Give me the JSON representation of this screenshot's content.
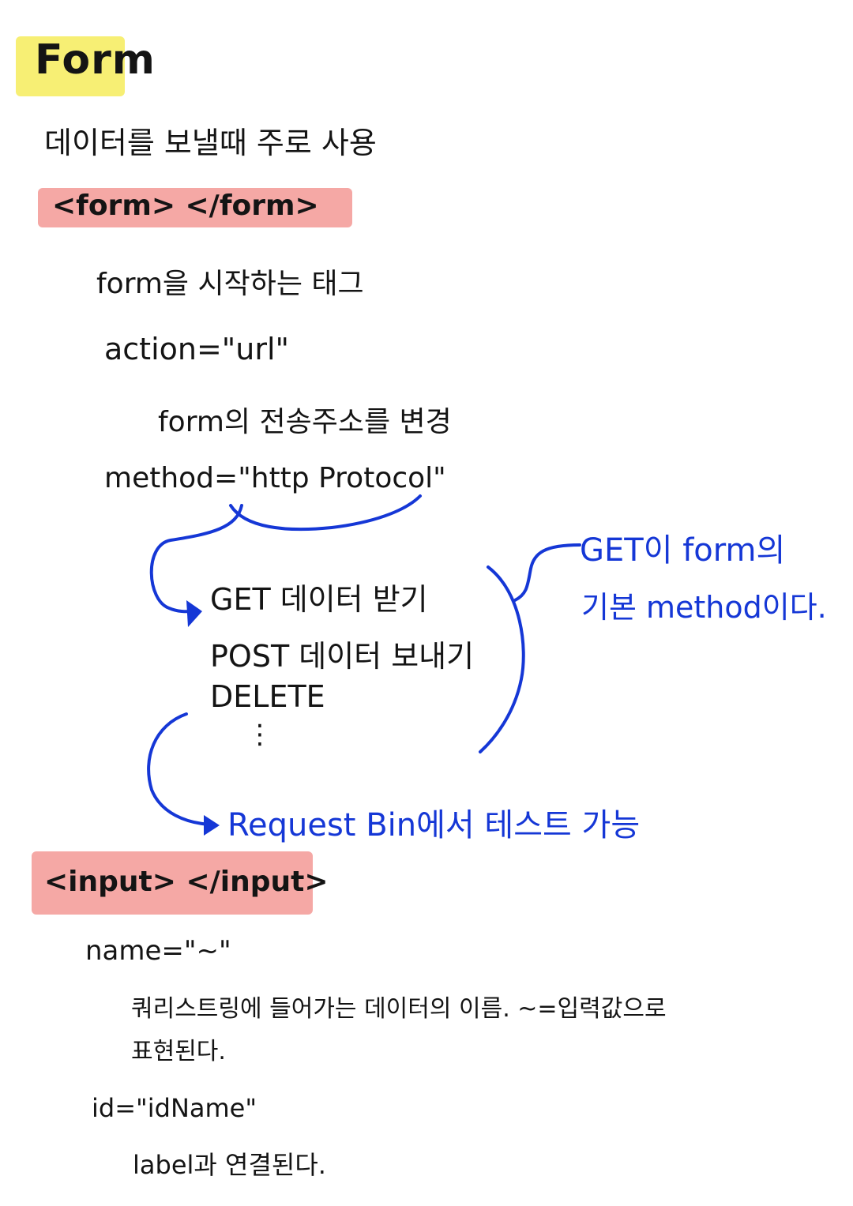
{
  "colors": {
    "ink": "#141414",
    "blue": "#1537d6",
    "highlight_yellow": "#f7ef74",
    "highlight_red": "#f4a3a0"
  },
  "title": "Form",
  "line_intro": "데이터를 보낼때 주로 사용",
  "form_tag": "<form> </form>",
  "form_desc": "form을 시작하는 태그",
  "action_attr": "action=\"url\"",
  "action_desc": "form의 전송주소를 변경",
  "method_attr": "method=\"http Protocol\"",
  "methods": {
    "get": "GET 데이터 받기",
    "post": "POST 데이터 보내기",
    "delete": "DELETE",
    "more": "⋮"
  },
  "note_get_line1": "GET이 form의",
  "note_get_line2": "기본 method이다.",
  "note_request_bin": "Request Bin에서 테스트 가능",
  "input_tag": "<input> </input>",
  "name_attr": "name=\"~\"",
  "name_desc_line1": "쿼리스트링에 들어가는 데이터의 이름. ~=입력값으로",
  "name_desc_line2": "표현된다.",
  "id_attr": "id=\"idName\"",
  "id_desc": "label과 연결된다."
}
